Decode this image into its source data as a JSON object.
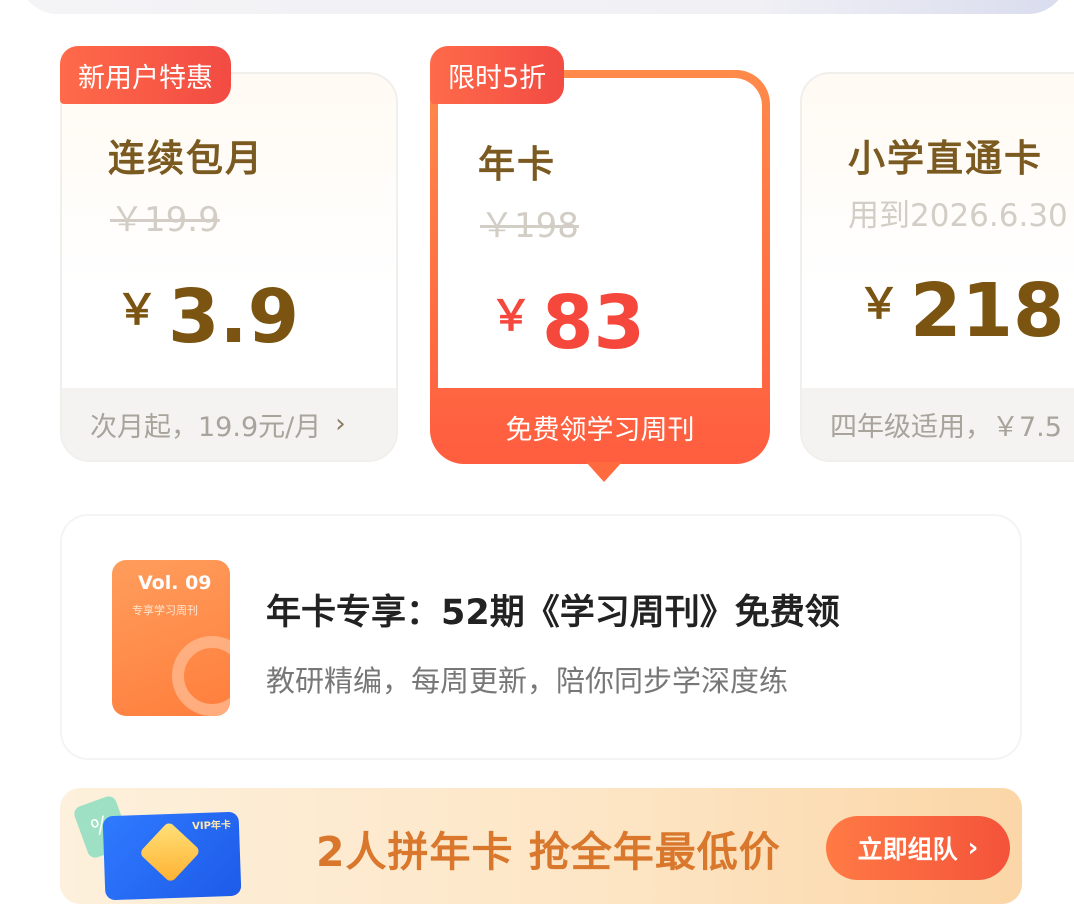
{
  "plans": [
    {
      "badge": "新用户特惠",
      "name": "连续包月",
      "original_price": "￥19.9",
      "currency": "￥",
      "price": "3.9",
      "footer": "次月起，19.9元/月"
    },
    {
      "badge": "限时5折",
      "name": "年卡",
      "original_price": "￥198",
      "currency": "￥",
      "price": "83",
      "footer": "免费领学习周刊",
      "selected": true
    },
    {
      "name": "小学直通卡",
      "validity": "用到2026.6.30",
      "currency": "￥",
      "price": "218",
      "footer": "四年级适用，￥7.5"
    }
  ],
  "weekly": {
    "cover_vol": "Vol. 09",
    "cover_subtitle": "专享学习周刊",
    "title": "年卡专享：52期《学习周刊》免费领",
    "description": "教研精编，每周更新，陪你同步学深度练"
  },
  "banner": {
    "vip_label": "VIP年卡",
    "tag_glyph": "%",
    "text": "2人拼年卡 抢全年最低价",
    "button": "立即组队"
  },
  "icons": {
    "chevron": "›"
  },
  "colors": {
    "accent": "#f5473c",
    "gold_text": "#7a5410",
    "banner_text": "#d9772d"
  }
}
